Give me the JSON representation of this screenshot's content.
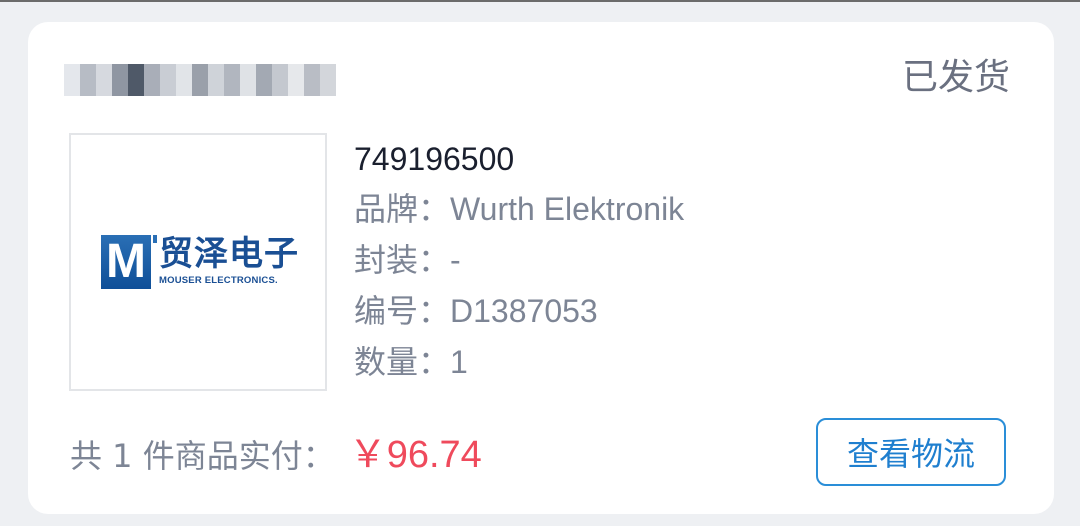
{
  "order": {
    "status": "已发货"
  },
  "product": {
    "logo": {
      "mark": "M",
      "name_cn": "贸泽电子",
      "name_en": "MOUSER ELECTRONICS."
    },
    "part_number": "749196500",
    "brand_label": "品牌：",
    "brand_value": "Wurth Elektronik",
    "package_label": "封装：",
    "package_value": "-",
    "code_label": "编号：",
    "code_value": "D1387053",
    "quantity_label": "数量：",
    "quantity_value": "1"
  },
  "summary": {
    "prefix": "共 1 件商品实付：",
    "price": "￥96.74"
  },
  "actions": {
    "logistics_label": "查看物流"
  },
  "colors": {
    "price": "#ef4a5c",
    "accent": "#2a8ed8",
    "brand_blue": "#1a4f94"
  }
}
